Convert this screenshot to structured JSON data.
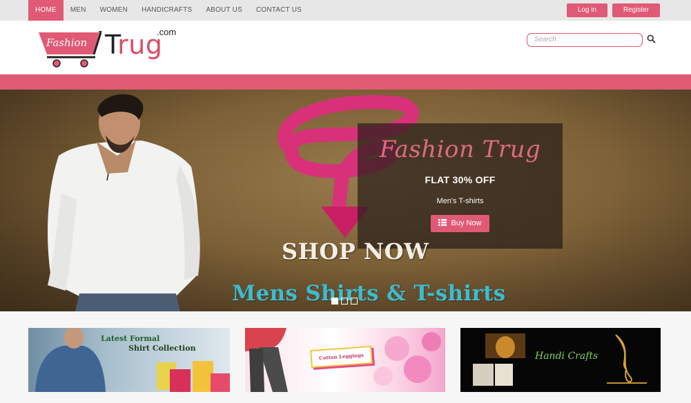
{
  "topnav": {
    "items": [
      {
        "label": "HOME",
        "active": true
      },
      {
        "label": "MEN"
      },
      {
        "label": "WOMEN"
      },
      {
        "label": "HANDICRAFTS"
      },
      {
        "label": "ABOUT US"
      },
      {
        "label": "CONTACT US"
      }
    ],
    "login_label": "Log in",
    "register_label": "Register"
  },
  "header": {
    "logo": {
      "fashion": "Fashion",
      "trug_t": "T",
      "trug_rest": "rug",
      "dotcom": ".com"
    },
    "search": {
      "placeholder": "Search :",
      "icon": "search-icon"
    }
  },
  "hero": {
    "caption": {
      "brand": "Fashion Trug",
      "offer": "FLAT 30% OFF",
      "subtitle": "Men's T-shirts",
      "button_label": "Buy Now",
      "button_icon": "list-icon"
    },
    "image_text": {
      "shop_now": "SHOP NOW",
      "mens_line": "Mens Shirts & T-shirts"
    },
    "slides": 3,
    "active_slide": 0
  },
  "cards": [
    {
      "line1": "Latest Formal",
      "line2": "Shirt Collection"
    },
    {
      "tag": "Cotton Leggings"
    },
    {
      "title": "Handi Crafts"
    }
  ],
  "colors": {
    "accent": "#e05a76",
    "band": "#df5b72",
    "nav_bg": "#e7e7e7"
  }
}
